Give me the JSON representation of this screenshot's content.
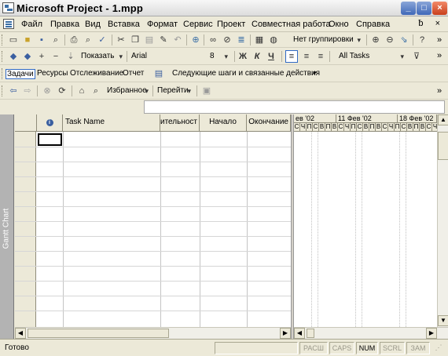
{
  "window": {
    "title": "Microsoft Project - 1.mpp"
  },
  "menu": {
    "items": [
      {
        "label": "Файл"
      },
      {
        "label": "Правка"
      },
      {
        "label": "Вид"
      },
      {
        "label": "Вставка"
      },
      {
        "label": "Формат"
      },
      {
        "label": "Сервис"
      },
      {
        "label": "Проект"
      },
      {
        "label": "Совместная работа"
      },
      {
        "label": "Окно"
      },
      {
        "label": "Справка"
      }
    ],
    "mdi_controls": "ƀ ×"
  },
  "toolbar_standard": {
    "grouping": "Нет группировки",
    "overflow": "»"
  },
  "toolbar_formatting": {
    "show_label": "Показать",
    "font": "Arial",
    "size": "8",
    "bold": "Ж",
    "italic": "К",
    "underline": "Ч",
    "filter": "All Tasks",
    "overflow": "»"
  },
  "project_guide": {
    "tasks": "Задачи",
    "resources": "Ресурсы",
    "tracking": "Отслеживание",
    "report": "Отчет",
    "next_steps": "Следующие шаги и связанные действия"
  },
  "web_toolbar": {
    "favorites": "Избранное",
    "goto": "Перейти",
    "overflow": "»"
  },
  "view_bar": {
    "label": "Gantt Chart"
  },
  "table": {
    "columns": [
      "",
      "",
      "Task Name",
      "ительност",
      "Начало",
      "Окончание"
    ]
  },
  "gantt": {
    "weeks": [
      "ев '02",
      "11 Фев '02",
      "18 Фев '02"
    ],
    "days": [
      "С",
      "Ч",
      "П",
      "С",
      "В",
      "П",
      "В",
      "С",
      "Ч",
      "П",
      "С",
      "В",
      "П",
      "В",
      "С",
      "Ч",
      "П",
      "С",
      "В",
      "П",
      "В",
      "С",
      "Ч"
    ]
  },
  "status": {
    "ready": "Готово",
    "panes": [
      "РАСШ",
      "CAPS",
      "NUM",
      "SCRL",
      "ЗАМ"
    ],
    "active": [
      "NUM"
    ]
  }
}
